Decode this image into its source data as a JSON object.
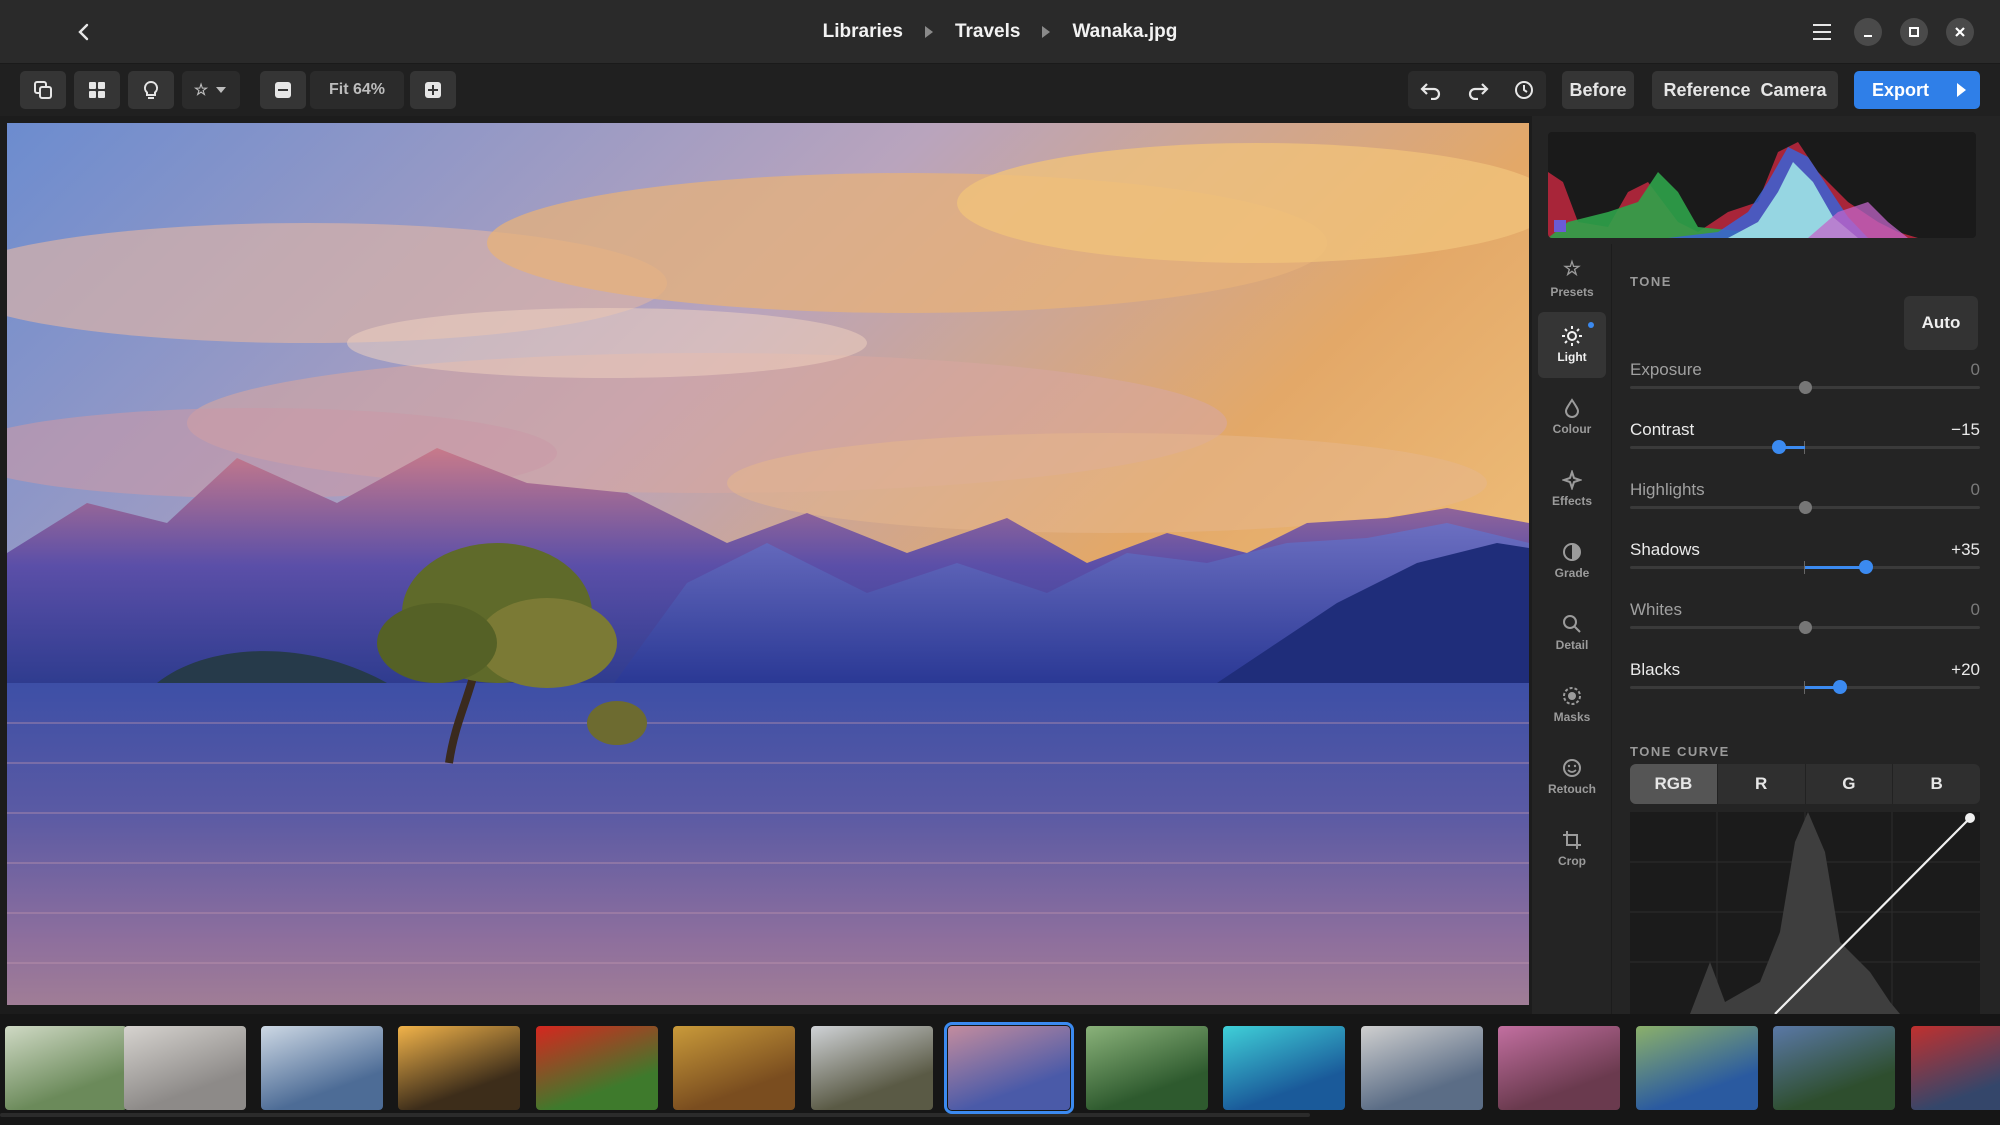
{
  "titlebar": {
    "breadcrumb": [
      "Libraries",
      "Travels",
      "Wanaka.jpg"
    ],
    "back_icon": "chevron-left-icon",
    "window_controls": [
      "menu-icon",
      "minimize-icon",
      "maximize-icon",
      "close-icon"
    ]
  },
  "toolbar": {
    "zoom_label": "Fit 64%",
    "before_label": "Before",
    "reference_label": "Reference",
    "camera_label": "Camera",
    "export_label": "Export"
  },
  "rail": {
    "items": [
      {
        "label": "Presets",
        "icon": "star-icon"
      },
      {
        "label": "Light",
        "icon": "sun-icon"
      },
      {
        "label": "Colour",
        "icon": "drop-icon"
      },
      {
        "label": "Effects",
        "icon": "sparkle-icon"
      },
      {
        "label": "Grade",
        "icon": "contrast-icon"
      },
      {
        "label": "Detail",
        "icon": "magnifier-icon"
      },
      {
        "label": "Masks",
        "icon": "mask-icon"
      },
      {
        "label": "Retouch",
        "icon": "face-icon"
      },
      {
        "label": "Crop",
        "icon": "crop-icon"
      }
    ],
    "active": "Light"
  },
  "tone": {
    "section_label": "TONE",
    "auto_label": "Auto",
    "sliders": [
      {
        "name": "Exposure",
        "value": "0",
        "amount": 0
      },
      {
        "name": "Contrast",
        "value": "−15",
        "amount": -15
      },
      {
        "name": "Highlights",
        "value": "0",
        "amount": 0
      },
      {
        "name": "Shadows",
        "value": "+35",
        "amount": 35
      },
      {
        "name": "Whites",
        "value": "0",
        "amount": 0
      },
      {
        "name": "Blacks",
        "value": "+20",
        "amount": 20
      }
    ]
  },
  "tone_curve": {
    "section_label": "TONE CURVE",
    "tabs": [
      "RGB",
      "R",
      "G",
      "B"
    ],
    "active_tab": "RGB"
  },
  "filmstrip": {
    "selected_index": 7,
    "count": 15
  },
  "colors": {
    "accent": "#3b8af0",
    "panel": "#242424",
    "titlebar": "#2a2a2a"
  }
}
